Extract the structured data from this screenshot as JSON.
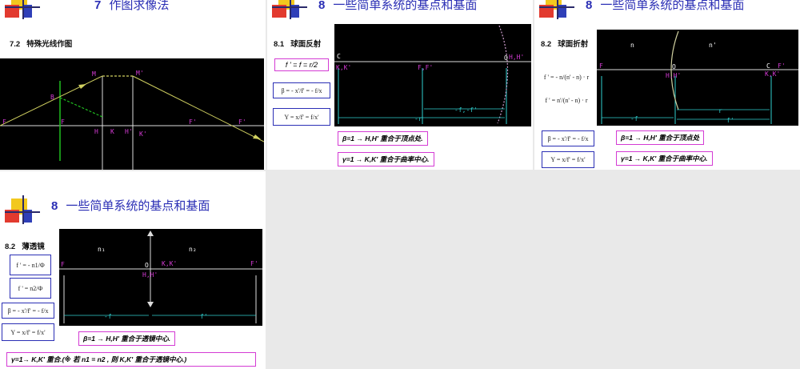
{
  "slide1": {
    "num": "7",
    "title": "作图求像法",
    "sub_num": "7.2",
    "sub_title": "特殊光线作图",
    "labels": {
      "M": "M",
      "Mp": "M'",
      "B": "B",
      "F": "F",
      "F_left": "F",
      "H": "H",
      "K": "K",
      "Hp": "H'",
      "Kp": "K'",
      "Fp_mid": "F'",
      "Fp_right": "F'"
    }
  },
  "slide2": {
    "num": "8",
    "title": "一些简单系统的基点和基面",
    "sub_num": "8.1",
    "sub_title": "球面反射",
    "formula_f": "f ' = f = r/2",
    "formula_beta": "β = - x'/f' = - f/x",
    "formula_gamma": "Υ = x/f' = f/x'",
    "note1": "β=1    →    H,H'    重合于顶点处.",
    "note2": "γ=1    →    K,K'   重合于曲率中心.",
    "labels": {
      "C": "C",
      "KKp": "K,K'",
      "FFp": "F,F'",
      "O": "O",
      "HHp": "H,H'",
      "r": "-r",
      "ff": "-f,-f'"
    }
  },
  "slide3": {
    "num": "8",
    "title": "一些简单系统的基点和基面",
    "sub_num": "8.2",
    "sub_title": "球面折射",
    "formula_f": "f ' = - n/(n' - n) · r",
    "formula_fp": "f ' = n'/(n' - n) · r",
    "formula_beta": "β = - x'/f' = - f/x",
    "formula_gamma": "Υ = x/f' = f/x'",
    "note1": "β=1    →    H,H'    重合于顶点处",
    "note2": "γ=1    →    K,K'   重合于曲率中心.",
    "labels": {
      "n": "n",
      "np": "n'",
      "F": "F",
      "O": "O",
      "HHp": "H,H'",
      "C": "C",
      "Fp": "F'",
      "KKp": "K,K'",
      "f": "-f",
      "r": "r",
      "fp": "f'"
    }
  },
  "slide4": {
    "num": "8",
    "title": "一些简单系统的基点和基面",
    "sub_num": "8.2",
    "sub_title": "薄透镜",
    "formula_f": "f ' = - n1/Φ",
    "formula_fp": "f ' = n2/Φ",
    "formula_beta": "β = - x'/f' = - f/x",
    "formula_gamma": "Υ = x/f' = f/x'",
    "note1": "β=1    →    H,H'    重合于透镜中心.",
    "note2": "γ=1→ K,K' 重合.(※  若  n1 = n2 , 则  K,K'  重合于透镜中心.)",
    "labels": {
      "n1": "n₁",
      "n2": "n₂",
      "F": "F",
      "O": "O",
      "KKp": "K,K'",
      "Fp": "F'",
      "HHp": "H,H'",
      "f": "-f",
      "fp": "f'"
    }
  },
  "colors": {
    "title": "#2b2fb5",
    "magenta": "#d43bd4",
    "cyan": "#30d0d0",
    "diagram_bg": "#000000",
    "ray": "#d0d060",
    "green": "#20c020"
  }
}
